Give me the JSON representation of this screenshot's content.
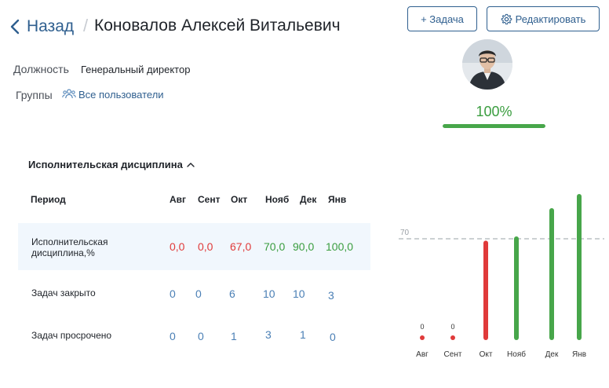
{
  "header": {
    "back_label": "Назад",
    "separator": "/",
    "name": "Коновалов Алексей Витальевич",
    "add_task_label": "+ Задача",
    "edit_label": "Редактировать"
  },
  "profile": {
    "position_label": "Должность",
    "position_value": "Генеральный директор",
    "groups_label": "Группы",
    "groups_value": "Все пользователи",
    "completion_text": "100%",
    "completion_fraction": 1.0
  },
  "discipline": {
    "title": "Исполнительская дисциплина",
    "period_header": "Период",
    "months": [
      "Авг",
      "Сент",
      "Окт",
      "Нояб",
      "Дек",
      "Янв"
    ],
    "rows": [
      {
        "label_line1": "Исполнительская",
        "label_line2": "дисциплина,%",
        "values": [
          "0,0",
          "0,0",
          "67,0",
          "70,0",
          "90,0",
          "100,0"
        ]
      },
      {
        "label_line1": "Задач закрыто",
        "label_line2": "",
        "values": [
          "0",
          "0",
          "6",
          "10",
          "10",
          "3"
        ]
      },
      {
        "label_line1": "Задач просрочено",
        "label_line2": "",
        "values": [
          "0",
          "0",
          "1",
          "3",
          "1",
          "0"
        ]
      }
    ]
  },
  "chart_data": {
    "type": "bar",
    "categories": [
      "Авг",
      "Сент",
      "Окт",
      "Нояб",
      "Дек",
      "Янв"
    ],
    "values": [
      0,
      0,
      67,
      70,
      90,
      100
    ],
    "zero_labels": [
      "0",
      "0"
    ],
    "threshold": 70,
    "threshold_label": "70",
    "ylim": [
      0,
      100
    ],
    "colors": {
      "below": "#e03a3a",
      "above": "#47a64a",
      "threshold": "#9aa0a6"
    }
  },
  "colors": {
    "red": "#e03a3a",
    "green": "#3a9d3f",
    "blue": "#4a7fb5",
    "accent": "#2f5f8f"
  }
}
